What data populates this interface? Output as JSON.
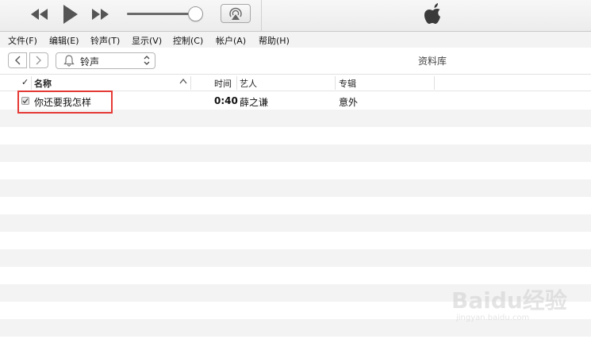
{
  "player": {
    "rewind_icon": "rewind-icon",
    "play_icon": "play-icon",
    "forward_icon": "fast-forward-icon",
    "volume_level": 0.9,
    "airplay_icon": "airplay-icon",
    "logo_icon": "apple-logo-icon"
  },
  "menu": {
    "items": [
      "文件(F)",
      "编辑(E)",
      "铃声(T)",
      "显示(V)",
      "控制(C)",
      "帐户(A)",
      "帮助(H)"
    ]
  },
  "nav": {
    "source_label": "铃声",
    "library_label": "资料库"
  },
  "table": {
    "columns": {
      "check": "✓",
      "name": "名称",
      "time": "时间",
      "artist": "艺人",
      "album": "专辑"
    },
    "rows": [
      {
        "checked": true,
        "name": "你还要我怎样",
        "time": "0:40",
        "artist": "薛之谦",
        "album": "意外"
      }
    ]
  },
  "watermark": {
    "main": "Baidu经验",
    "sub": "jingyan.baidu.com"
  },
  "colors": {
    "highlight": "#e53935",
    "stripe": "#f3f3f3"
  }
}
